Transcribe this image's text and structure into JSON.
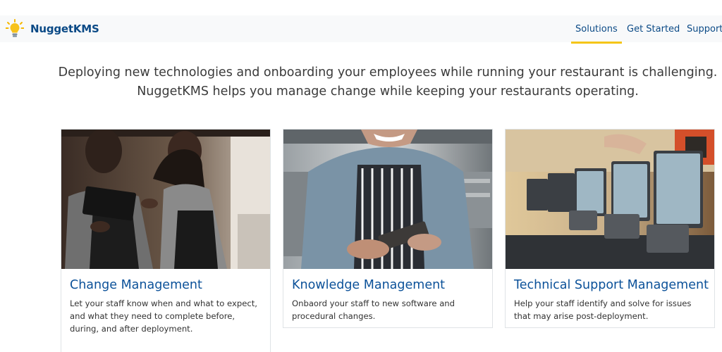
{
  "brand": {
    "name": "NuggetKMS",
    "icon": "lightbulb-icon",
    "accent_color": "#f5c518"
  },
  "nav": {
    "links": [
      {
        "label": "Solutions",
        "active": true
      },
      {
        "label": "Get Started",
        "active": false
      },
      {
        "label": "Support",
        "active": false
      }
    ]
  },
  "hero": {
    "line1": "Deploying new technologies and onboarding your employees while running your restaurant is challenging.",
    "line2": "NuggetKMS helps you manage change while keeping your restaurants operating."
  },
  "cards": [
    {
      "title": "Change Management",
      "text": "Let your staff know when and what to expect, and what they need to complete before, during, and after deployment.",
      "image": "staff-with-tablet-photo"
    },
    {
      "title": "Knowledge Management",
      "text": "Onbaord your staff to new software and procedural changes.",
      "image": "server-in-kitchen-photo"
    },
    {
      "title": "Technical Support Management",
      "text": "Help your staff identify and solve for issues that may arise post-deployment.",
      "image": "pos-terminals-photo"
    }
  ],
  "colors": {
    "link": "#0b4a86",
    "title": "#0b5199",
    "navbar_bg": "#f8f9fa"
  }
}
